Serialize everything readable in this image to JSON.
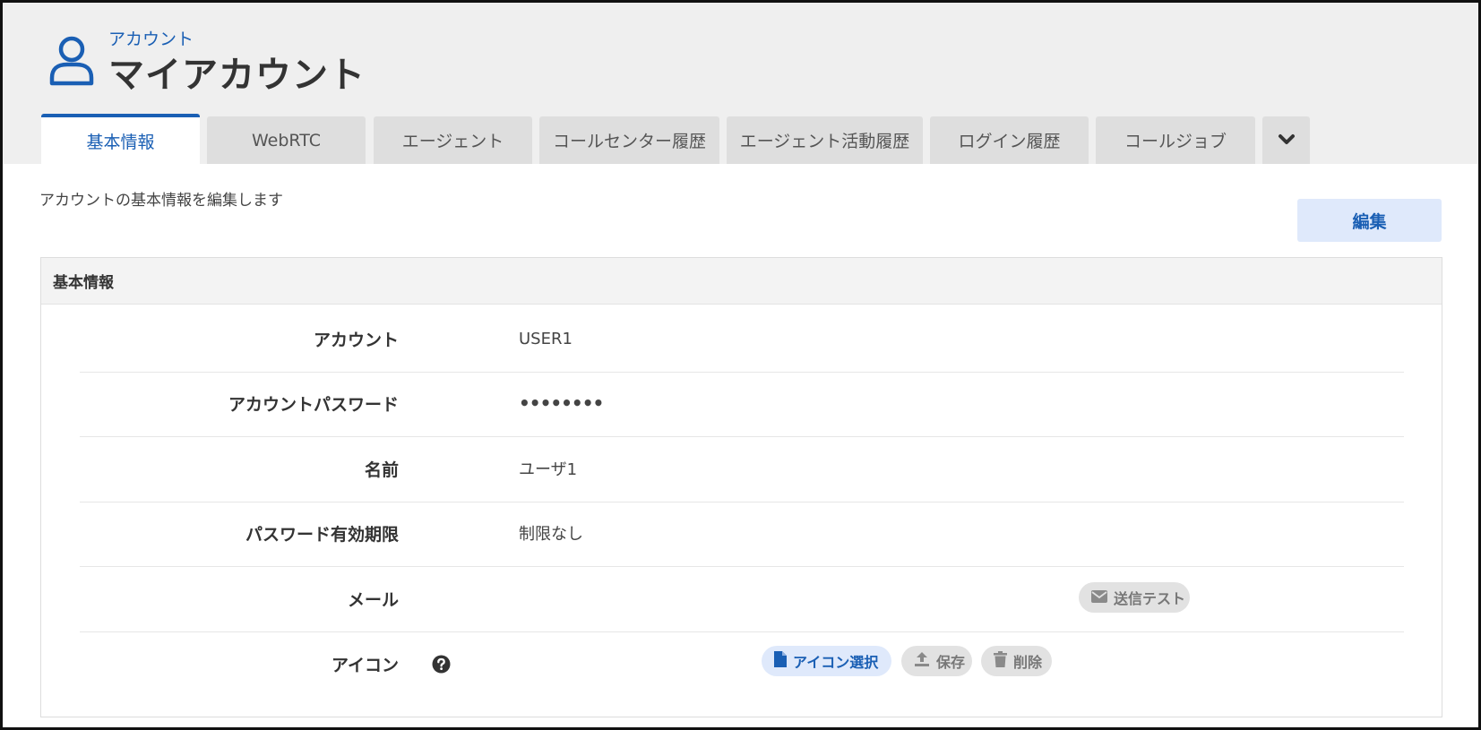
{
  "header": {
    "breadcrumb": "アカウント",
    "title": "マイアカウント"
  },
  "tabs": [
    {
      "label": "基本情報",
      "active": true
    },
    {
      "label": "WebRTC",
      "active": false
    },
    {
      "label": "エージェント",
      "active": false
    },
    {
      "label": "コールセンター履歴",
      "active": false
    },
    {
      "label": "エージェント活動履歴",
      "active": false
    },
    {
      "label": "ログイン履歴",
      "active": false
    },
    {
      "label": "コールジョブ",
      "active": false
    }
  ],
  "content": {
    "description": "アカウントの基本情報を編集します",
    "edit_label": "編集"
  },
  "panel": {
    "title": "基本情報",
    "rows": [
      {
        "label": "アカウント",
        "value": "USER1"
      },
      {
        "label": "アカウントパスワード",
        "value": "••••••••"
      },
      {
        "label": "名前",
        "value": "ユーザ1"
      },
      {
        "label": "パスワード有効期限",
        "value": "制限なし"
      },
      {
        "label": "メール",
        "value": ""
      },
      {
        "label": "アイコン",
        "value": ""
      }
    ],
    "send_test_label": "送信テスト",
    "icon_select_label": "アイコン選択",
    "icon_save_label": "保存",
    "icon_delete_label": "削除"
  },
  "colors": {
    "accent": "#1a5fb4",
    "header_bg": "#efefef",
    "tab_bg": "#dedede",
    "accent_light": "#dfe9fb"
  }
}
